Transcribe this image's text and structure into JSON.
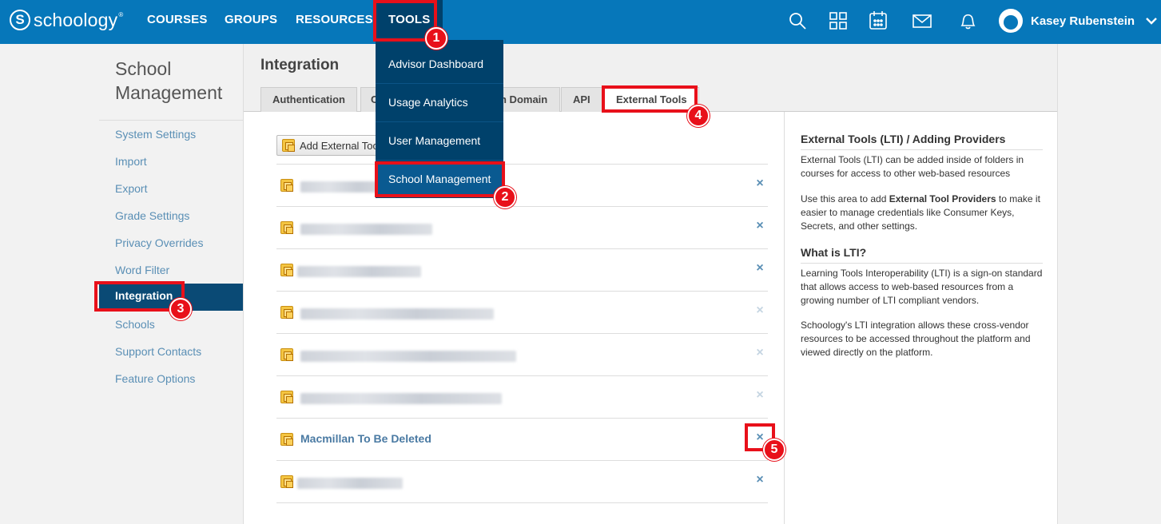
{
  "header": {
    "logo_text": "schoology",
    "logo_mark": "S",
    "logo_tm": "®",
    "nav": [
      "COURSES",
      "GROUPS",
      "RESOURCES",
      "TOOLS"
    ],
    "user_name": "Kasey Rubenstein",
    "icons": [
      "search-icon",
      "apps-grid-icon",
      "calendar-icon",
      "mail-icon",
      "notifications-bell-icon",
      "chevron-down-icon"
    ]
  },
  "tools_menu": {
    "items": [
      "Advisor Dashboard",
      "Usage Analytics",
      "User Management",
      "School Management"
    ],
    "selected": "School Management"
  },
  "sidebar": {
    "title": "School Management",
    "items": [
      "System Settings",
      "Import",
      "Export",
      "Grade Settings",
      "Privacy Overrides",
      "Word Filter",
      "Integration",
      "Schools",
      "Support Contacts",
      "Feature Options"
    ],
    "active": "Integration"
  },
  "main": {
    "title": "Integration",
    "tabs": [
      "Authentication",
      "C",
      "n Domain",
      "API",
      "External Tools"
    ],
    "active_tab": "External Tools",
    "add_button": "Add External Too",
    "rows": [
      {
        "name": "",
        "blurred": true,
        "deletable": true
      },
      {
        "name": "",
        "blurred": true,
        "deletable": true
      },
      {
        "name": "",
        "blurred": true,
        "deletable": true
      },
      {
        "name": "",
        "blurred": true,
        "deletable": false
      },
      {
        "name": "",
        "blurred": true,
        "deletable": false
      },
      {
        "name": "",
        "blurred": true,
        "deletable": false
      },
      {
        "name": "Macmillan To Be Deleted",
        "blurred": false,
        "deletable": true
      },
      {
        "name": "",
        "blurred": true,
        "deletable": true
      }
    ],
    "delete_symbol": "×"
  },
  "help": {
    "heading1": "External Tools (LTI) / Adding Providers",
    "p1": "External Tools (LTI) can be added inside of folders in courses for access to other web-based resources",
    "p2_before": "Use this area to add ",
    "p2_bold": "External Tool Providers",
    "p2_after": " to make it easier to manage credentials like Consumer Keys, Secrets, and other settings.",
    "heading2": "What is LTI?",
    "p3": "Learning Tools Interoperability (LTI) is a sign-on standard that allows access to web-based resources from a growing number of LTI compliant vendors.",
    "p4": "Schoology's LTI integration allows these cross-vendor resources to be accessed throughout the platform and viewed directly on the platform."
  },
  "annotations": [
    "1",
    "2",
    "3",
    "4",
    "5"
  ],
  "colors": {
    "brand": "#0677ba",
    "dark_nav": "#00416b",
    "highlight": "#e8101a",
    "link": "#5a8fb5"
  }
}
